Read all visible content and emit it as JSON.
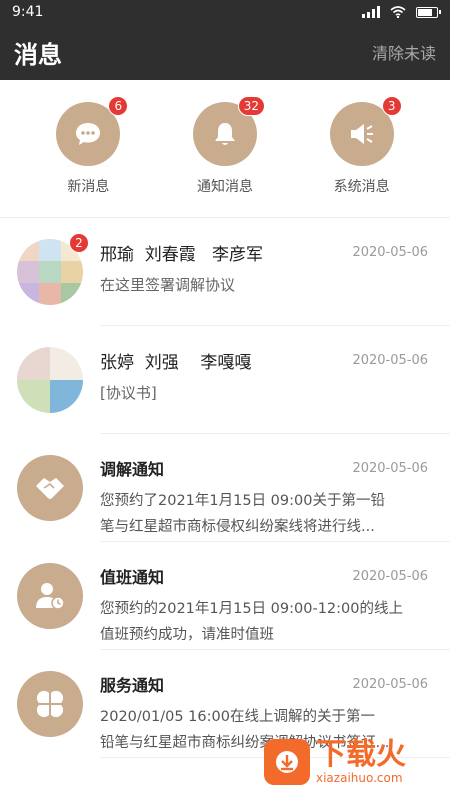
{
  "status_bar": {
    "time": "9:41"
  },
  "header": {
    "title": "消息",
    "clear_label": "清除未读"
  },
  "categories": [
    {
      "label": "新消息",
      "badge": "6",
      "icon": "chat-bubble-icon"
    },
    {
      "label": "通知消息",
      "badge": "32",
      "icon": "bell-icon"
    },
    {
      "label": "系统消息",
      "badge": "3",
      "icon": "megaphone-icon"
    }
  ],
  "messages": [
    {
      "names": "邢瑜  刘春霞   李彦军",
      "date": "2020-05-06",
      "preview": "在这里签署调解协议",
      "badge": "2"
    },
    {
      "names": "张婷  刘强    李嘎嘎",
      "date": "2020-05-06",
      "preview": "[协议书]"
    },
    {
      "title": "调解通知",
      "date": "2020-05-06",
      "line1": "您预约了2021年1月15日  09:00关于第一铅",
      "line2": "笔与红星超市商标侵权纠纷案线将进行线...",
      "icon": "handshake-icon"
    },
    {
      "title": "值班通知",
      "date": "2020-05-06",
      "line1": "您预约的2021年1月15日 09:00-12:00的线上",
      "line2": "值班预约成功，请准时值班",
      "icon": "user-clock-icon"
    },
    {
      "title": "服务通知",
      "date": "2020-05-06",
      "line1": "2020/01/05  16:00在线上调解的关于第一",
      "line2": "铅笔与红星超市商标纠纷案调解协议书签订...",
      "icon": "clover-icon"
    }
  ],
  "watermark": {
    "main": "下载火",
    "sub": "xiazaihuo.com"
  },
  "colors": {
    "accent": "#c9ab8e",
    "header_bg": "#2f2f2f",
    "badge": "#e53935"
  }
}
